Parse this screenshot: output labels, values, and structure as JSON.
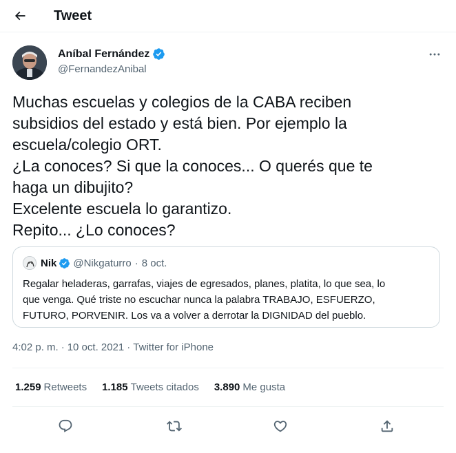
{
  "header": {
    "title": "Tweet"
  },
  "author": {
    "name": "Aníbal Fernández",
    "handle": "@FernandezAnibal"
  },
  "tweet": {
    "lines": [
      "Muchas escuelas y colegios de la CABA reciben",
      "subsidios del estado y está bien. Por ejemplo la",
      "escuela/colegio ORT.",
      "¿La conoces? Si que la conoces... O querés que te",
      "haga un dibujito?",
      "Excelente escuela lo garantizo.",
      "Repito... ¿Lo conoces?"
    ]
  },
  "quote": {
    "name": "Nik",
    "handle": "@Nikgaturro",
    "dot": "·",
    "date": "8 oct.",
    "lines": [
      "Regalar heladeras, garrafas, viajes de egresados, planes, platita, lo que sea, lo",
      "que venga. Qué triste no escuchar nunca la palabra TRABAJO, ESFUERZO,",
      "FUTURO, PORVENIR. Los va a volver a derrotar la DIGNIDAD del pueblo."
    ]
  },
  "meta": {
    "time": "4:02 p. m.",
    "separator": "·",
    "date": "10 oct. 2021",
    "source": "Twitter for iPhone"
  },
  "stats": [
    {
      "value": "1.259",
      "label": "Retweets"
    },
    {
      "value": "1.185",
      "label": "Tweets citados"
    },
    {
      "value": "3.890",
      "label": "Me gusta"
    }
  ],
  "icons": {
    "back": "arrow-left-icon",
    "more": "more-horizontal-icon",
    "verified": "verified-badge-icon",
    "reply": "reply-icon",
    "retweet": "retweet-icon",
    "like": "heart-icon",
    "share": "share-icon"
  },
  "colors": {
    "verified": "#1d9bf0",
    "text": "#0f1419",
    "secondary": "#536471",
    "border": "#cfd9de"
  }
}
